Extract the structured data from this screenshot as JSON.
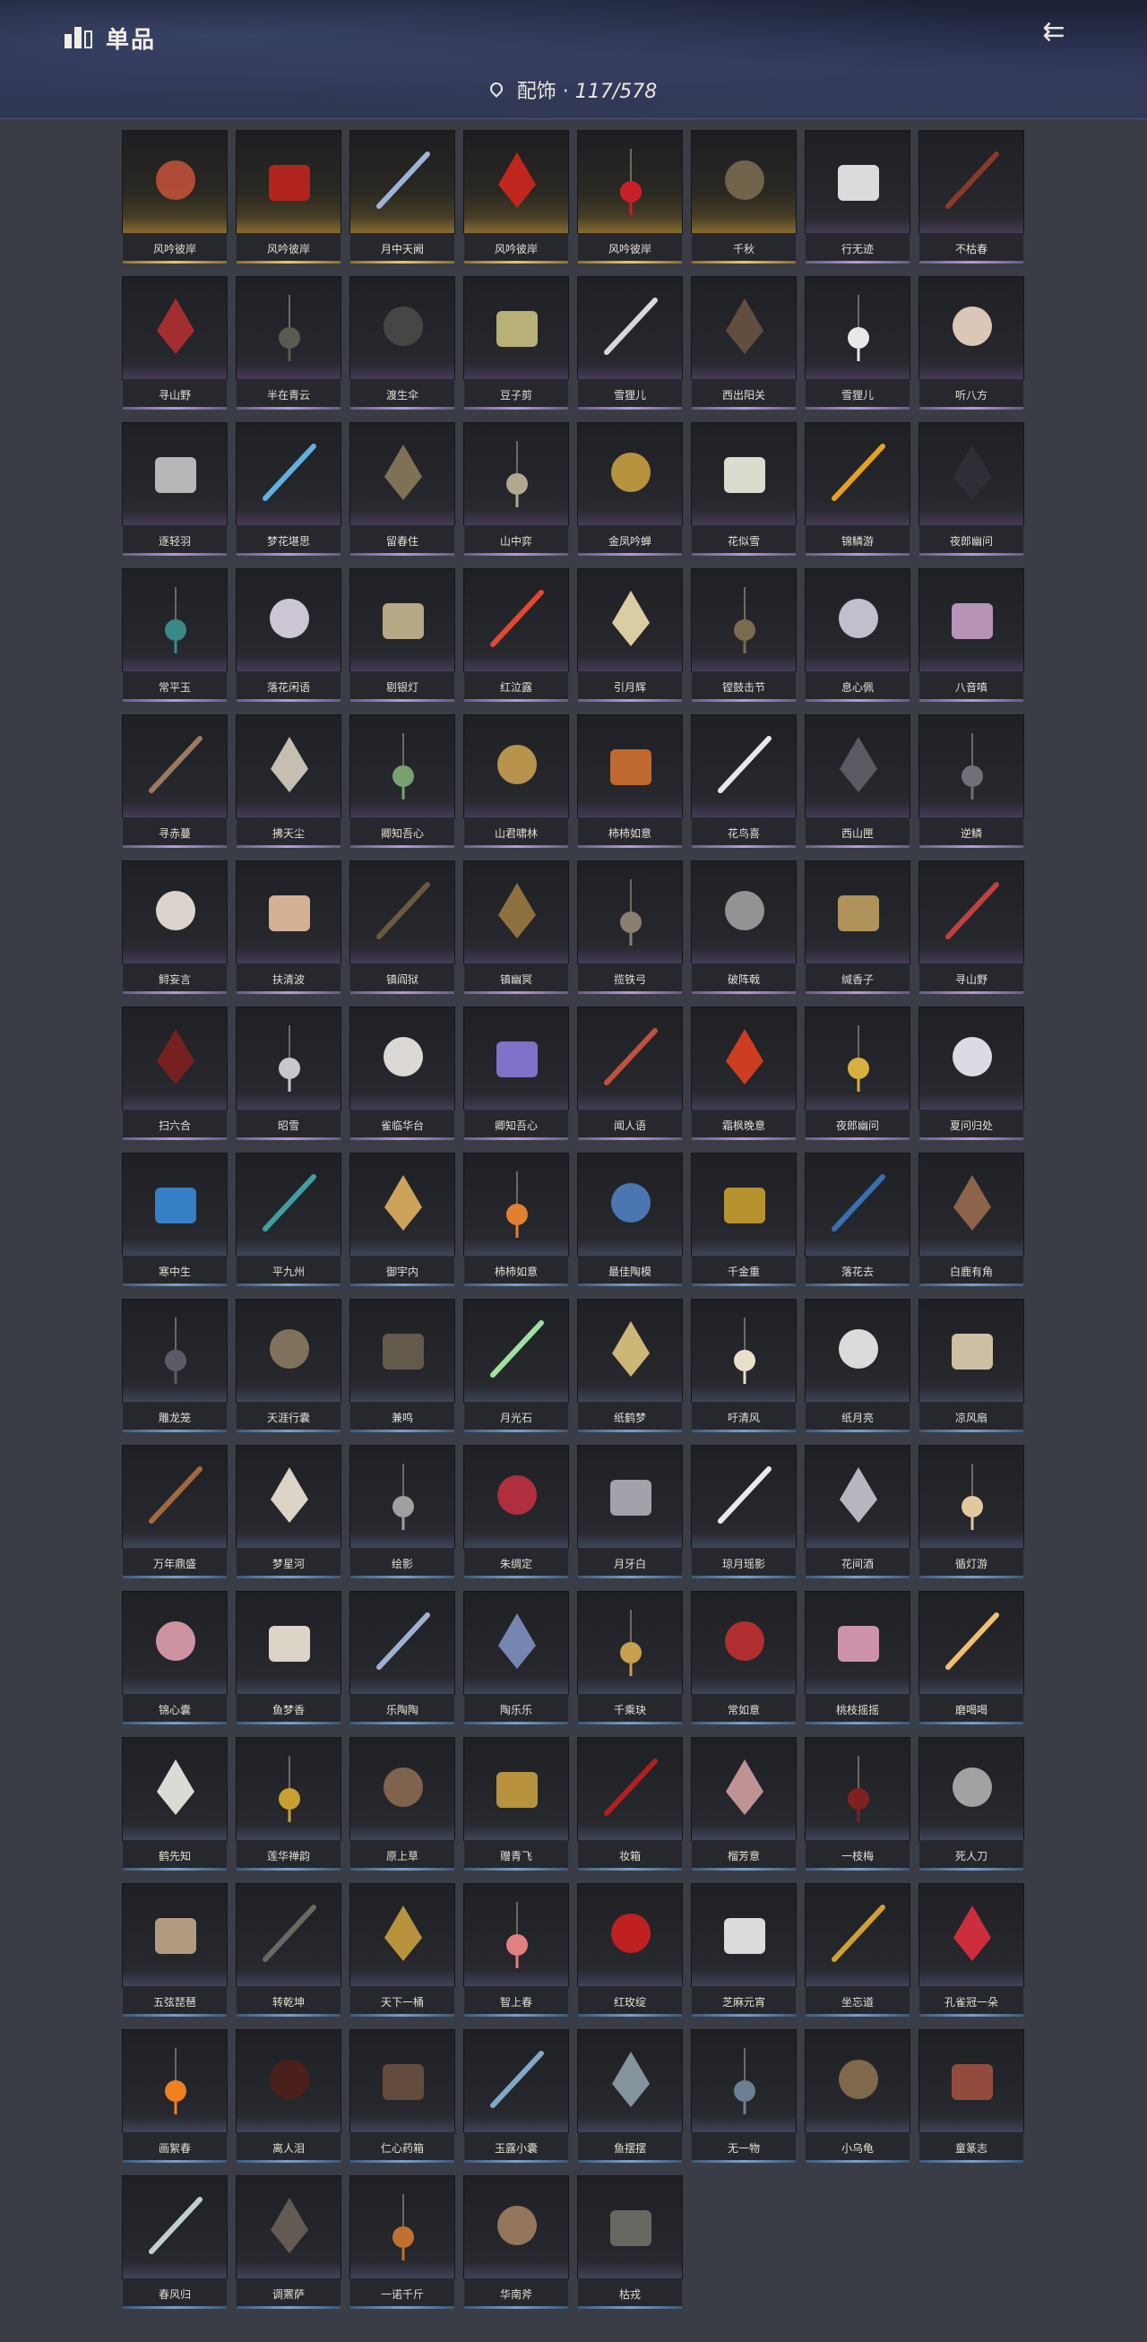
{
  "header": {
    "title": "单品",
    "subtitle_label": "配饰",
    "subtitle_count": "117/578",
    "back_icon": "back-arrow-icon"
  },
  "items": [
    {
      "label": "风吟彼岸",
      "tier": "gold",
      "color": "#c0503a"
    },
    {
      "label": "风吟彼岸",
      "tier": "gold",
      "color": "#c0241e"
    },
    {
      "label": "月中天阙",
      "tier": "gold",
      "color": "#9db4d8"
    },
    {
      "label": "风吟彼岸",
      "tier": "gold",
      "color": "#d0281e"
    },
    {
      "label": "风吟彼岸",
      "tier": "gold",
      "color": "#c8202a"
    },
    {
      "label": "千秋",
      "tier": "gold",
      "color": "#7a6a50"
    },
    {
      "label": "行无迹",
      "tier": "purple",
      "color": "#f0f0f0"
    },
    {
      "label": "不枯春",
      "tier": "purple",
      "color": "#8a3a2a"
    },
    {
      "label": "寻山野",
      "tier": "purple",
      "color": "#b03030"
    },
    {
      "label": "半在青云",
      "tier": "purple",
      "color": "#5a5a50"
    },
    {
      "label": "渡生伞",
      "tier": "purple",
      "color": "#4a4a48"
    },
    {
      "label": "豆子剪",
      "tier": "purple",
      "color": "#c8c080"
    },
    {
      "label": "雪狸儿",
      "tier": "purple",
      "color": "#d8d8dc"
    },
    {
      "label": "西出阳关",
      "tier": "purple",
      "color": "#6a5240"
    },
    {
      "label": "雪狸儿",
      "tier": "purple",
      "color": "#e8e8e8"
    },
    {
      "label": "听八方",
      "tier": "purple",
      "color": "#f0d8c8"
    },
    {
      "label": "逐轻羽",
      "tier": "purple",
      "color": "#c8c8c8"
    },
    {
      "label": "梦花堪思",
      "tier": "purple",
      "color": "#60b0e0"
    },
    {
      "label": "留春住",
      "tier": "purple",
      "color": "#8a7a5a"
    },
    {
      "label": "山中弈",
      "tier": "purple",
      "color": "#b0a890"
    },
    {
      "label": "金凤吟蝉",
      "tier": "purple",
      "color": "#c8a040"
    },
    {
      "label": "花似雪",
      "tier": "purple",
      "color": "#f0f0e0"
    },
    {
      "label": "锦鳞游",
      "tier": "purple",
      "color": "#e8a020"
    },
    {
      "label": "夜郎幽问",
      "tier": "purple",
      "color": "#303038"
    },
    {
      "label": "常平玉",
      "tier": "purple",
      "color": "#3a8a8a"
    },
    {
      "label": "落花闲语",
      "tier": "purple",
      "color": "#e0d8e8"
    },
    {
      "label": "剔银灯",
      "tier": "purple",
      "color": "#c8b890"
    },
    {
      "label": "红泣露",
      "tier": "purple",
      "color": "#e04830"
    },
    {
      "label": "引月辉",
      "tier": "purple",
      "color": "#f0e0b0"
    },
    {
      "label": "镗鼓击节",
      "tier": "purple",
      "color": "#7a6a50"
    },
    {
      "label": "息心佩",
      "tier": "purple",
      "color": "#d0d0e0"
    },
    {
      "label": "八音嗔",
      "tier": "purple",
      "color": "#c8a0c8"
    },
    {
      "label": "寻赤蔓",
      "tier": "purple",
      "color": "#9a7a60"
    },
    {
      "label": "拂天尘",
      "tier": "purple",
      "color": "#d8d0c0"
    },
    {
      "label": "卿知吾心",
      "tier": "purple",
      "color": "#78a070"
    },
    {
      "label": "山君啸林",
      "tier": "purple",
      "color": "#c8a050"
    },
    {
      "label": "柿柿如意",
      "tier": "purple",
      "color": "#d07030"
    },
    {
      "label": "花鸟喜",
      "tier": "purple",
      "color": "#e8e8e8"
    },
    {
      "label": "西山匣",
      "tier": "purple",
      "color": "#606068"
    },
    {
      "label": "逆鳞",
      "tier": "purple",
      "color": "#707078"
    },
    {
      "label": "鲟妄言",
      "tier": "purple",
      "color": "#f0e8e0"
    },
    {
      "label": "扶清波",
      "tier": "purple",
      "color": "#e8c0a0"
    },
    {
      "label": "镇阎狱",
      "tier": "purple",
      "color": "#6a5a40"
    },
    {
      "label": "镇幽冥",
      "tier": "purple",
      "color": "#9a7a40"
    },
    {
      "label": "揽铁弓",
      "tier": "purple",
      "color": "#8a8070"
    },
    {
      "label": "破阵戟",
      "tier": "purple",
      "color": "#a0a0a0"
    },
    {
      "label": "缄香子",
      "tier": "purple",
      "color": "#c0a060"
    },
    {
      "label": "寻山野",
      "tier": "purple",
      "color": "#c04040"
    },
    {
      "label": "扫六合",
      "tier": "purple",
      "color": "#802020"
    },
    {
      "label": "昭雪",
      "tier": "purple",
      "color": "#c8c8c8"
    },
    {
      "label": "雀临华台",
      "tier": "purple",
      "color": "#f0ece8"
    },
    {
      "label": "卿知吾心",
      "tier": "purple",
      "color": "#8a7ad8"
    },
    {
      "label": "闻人语",
      "tier": "purple",
      "color": "#c05040"
    },
    {
      "label": "霜枫晚意",
      "tier": "purple",
      "color": "#e04020"
    },
    {
      "label": "夜郎幽问",
      "tier": "purple",
      "color": "#d8b040"
    },
    {
      "label": "夏问归处",
      "tier": "purple",
      "color": "#f0f0f8"
    },
    {
      "label": "寒中生",
      "tier": "blue",
      "color": "#3a8ad8"
    },
    {
      "label": "平九州",
      "tier": "blue",
      "color": "#40a0a0"
    },
    {
      "label": "御宇内",
      "tier": "blue",
      "color": "#e0b060"
    },
    {
      "label": "柿柿如意",
      "tier": "blue",
      "color": "#e08030"
    },
    {
      "label": "最佳陶模",
      "tier": "blue",
      "color": "#5080c0"
    },
    {
      "label": "千金重",
      "tier": "blue",
      "color": "#c8a030"
    },
    {
      "label": "落花去",
      "tier": "blue",
      "color": "#3a70b0"
    },
    {
      "label": "白鹿有角",
      "tier": "blue",
      "color": "#9a6a50"
    },
    {
      "label": "雕龙笼",
      "tier": "blue",
      "color": "#5a5a68"
    },
    {
      "label": "天涯行囊",
      "tier": "blue",
      "color": "#8a7a60"
    },
    {
      "label": "兼鸣",
      "tier": "blue",
      "color": "#6a6050"
    },
    {
      "label": "月光石",
      "tier": "blue",
      "color": "#a0e0a0"
    },
    {
      "label": "纸鹤梦",
      "tier": "blue",
      "color": "#e0c880"
    },
    {
      "label": "吁清风",
      "tier": "blue",
      "color": "#e8e0c8"
    },
    {
      "label": "纸月亮",
      "tier": "blue",
      "color": "#f0f0f0"
    },
    {
      "label": "凉风扇",
      "tier": "blue",
      "color": "#e0d0b0"
    },
    {
      "label": "万年鼎盛",
      "tier": "blue",
      "color": "#a06a40"
    },
    {
      "label": "梦星河",
      "tier": "blue",
      "color": "#f0e8d8"
    },
    {
      "label": "绘影",
      "tier": "blue",
      "color": "#a0a0a0"
    },
    {
      "label": "朱绸定",
      "tier": "blue",
      "color": "#c03040"
    },
    {
      "label": "月牙白",
      "tier": "blue",
      "color": "#b0b0b8"
    },
    {
      "label": "琼月瑶影",
      "tier": "blue",
      "color": "#e8e8f0"
    },
    {
      "label": "花间酒",
      "tier": "blue",
      "color": "#c8c8d0"
    },
    {
      "label": "循灯游",
      "tier": "blue",
      "color": "#e0c8a0"
    },
    {
      "label": "锦心囊",
      "tier": "blue",
      "color": "#e0a0b0"
    },
    {
      "label": "鱼梦香",
      "tier": "blue",
      "color": "#f0e8d8"
    },
    {
      "label": "乐陶陶",
      "tier": "blue",
      "color": "#a0b0d0"
    },
    {
      "label": "陶乐乐",
      "tier": "blue",
      "color": "#8090c0"
    },
    {
      "label": "千乘玦",
      "tier": "blue",
      "color": "#c8a050"
    },
    {
      "label": "常如意",
      "tier": "blue",
      "color": "#c03030"
    },
    {
      "label": "桃枝摇摇",
      "tier": "blue",
      "color": "#e0a0b8"
    },
    {
      "label": "磨喝喝",
      "tier": "blue",
      "color": "#f0c070"
    },
    {
      "label": "鹤先知",
      "tier": "blue",
      "color": "#f0f0e8"
    },
    {
      "label": "莲华禅韵",
      "tier": "blue",
      "color": "#c8a030"
    },
    {
      "label": "原上草",
      "tier": "blue",
      "color": "#8a6a50"
    },
    {
      "label": "赠青飞",
      "tier": "blue",
      "color": "#c8a040"
    },
    {
      "label": "妆箱",
      "tier": "blue",
      "color": "#b02020"
    },
    {
      "label": "榴芳意",
      "tier": "blue",
      "color": "#d0a0a0"
    },
    {
      "label": "一枝梅",
      "tier": "blue",
      "color": "#802020"
    },
    {
      "label": "死人刀",
      "tier": "blue",
      "color": "#b0b0b0"
    },
    {
      "label": "五弦琵琶",
      "tier": "blue",
      "color": "#c0a888"
    },
    {
      "label": "转乾坤",
      "tier": "blue",
      "color": "#6a6a60"
    },
    {
      "label": "天下一桶",
      "tier": "blue",
      "color": "#c8a040"
    },
    {
      "label": "智上春",
      "tier": "blue",
      "color": "#e08080"
    },
    {
      "label": "红玫绽",
      "tier": "blue",
      "color": "#d02020"
    },
    {
      "label": "芝麻元宵",
      "tier": "blue",
      "color": "#f0f0f0"
    },
    {
      "label": "坐忘道",
      "tier": "blue",
      "color": "#d0a030"
    },
    {
      "label": "孔雀冠一朵",
      "tier": "blue",
      "color": "#e03040"
    },
    {
      "label": "画絮春",
      "tier": "blue",
      "color": "#f08020"
    },
    {
      "label": "离人泪",
      "tier": "blue",
      "color": "#502018"
    },
    {
      "label": "仁心药箱",
      "tier": "blue",
      "color": "#6a5040"
    },
    {
      "label": "玉露小囊",
      "tier": "blue",
      "color": "#80a8c8"
    },
    {
      "label": "鱼摆摆",
      "tier": "blue",
      "color": "#90a0a8"
    },
    {
      "label": "无一物",
      "tier": "blue",
      "color": "#6a8090"
    },
    {
      "label": "小乌龟",
      "tier": "blue",
      "color": "#8a7050"
    },
    {
      "label": "童篆志",
      "tier": "blue",
      "color": "#a05040"
    },
    {
      "label": "春风归",
      "tier": "blue",
      "color": "#c0d0d0"
    },
    {
      "label": "调罴萨",
      "tier": "blue",
      "color": "#6a6058"
    },
    {
      "label": "一诺千斤",
      "tier": "blue",
      "color": "#c07030"
    },
    {
      "label": "华南斧",
      "tier": "blue",
      "color": "#a08060"
    },
    {
      "label": "枯戎",
      "tier": "blue",
      "color": "#707068"
    }
  ]
}
